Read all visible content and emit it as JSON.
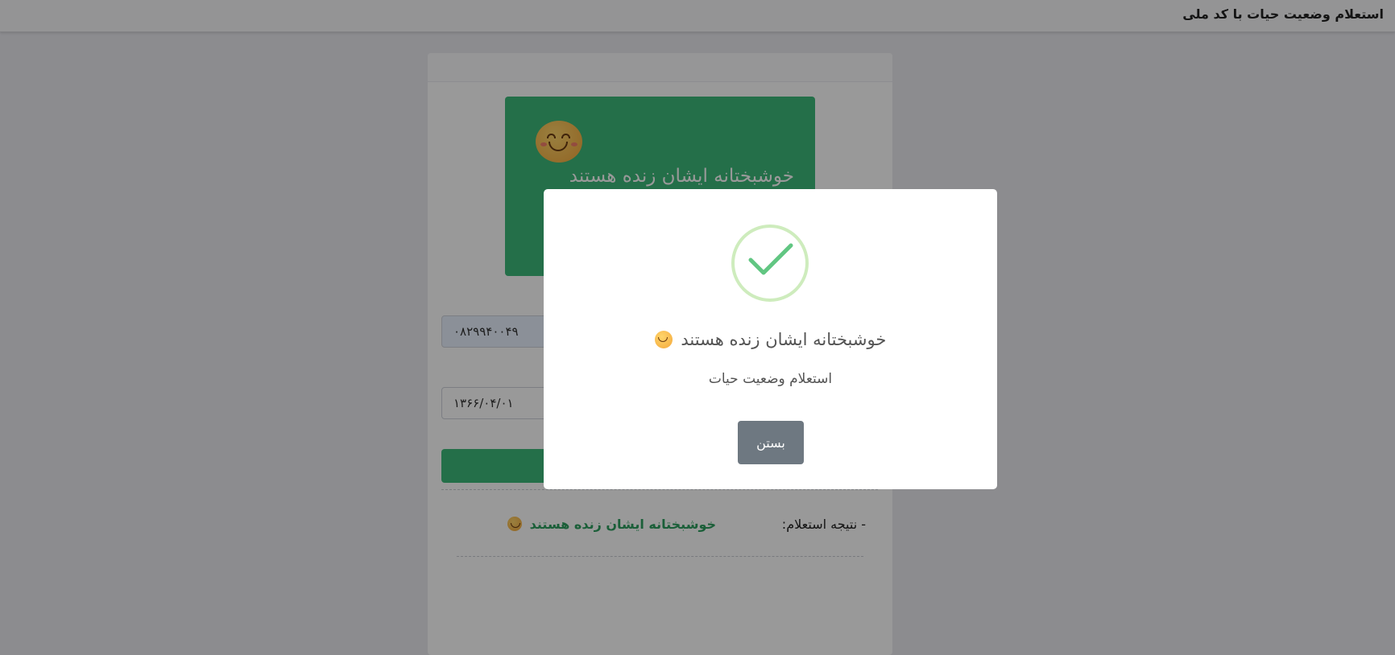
{
  "header": {
    "title": "استعلام وضعیت حیات با کد ملی"
  },
  "card": {
    "banner_text": "خوشبختانه ایشان زنده هستند",
    "banner_icon": "smiling-face-icon",
    "national_code_value": "۰۸۲۹۹۴۰۰۴۹",
    "birth_date_value": "۱۳۶۶/۰۴/۰۱",
    "result_label": "- نتیجه استعلام:",
    "result_value": "خوشبختانه ایشان زنده هستند",
    "accent_color": "#3cb97a"
  },
  "modal": {
    "icon": "success-check-icon",
    "title": "خوشبختانه ایشان زنده هستند",
    "text": "استعلام وضعیت حیات",
    "close_label": "بستن",
    "close_color": "#6e7881"
  }
}
